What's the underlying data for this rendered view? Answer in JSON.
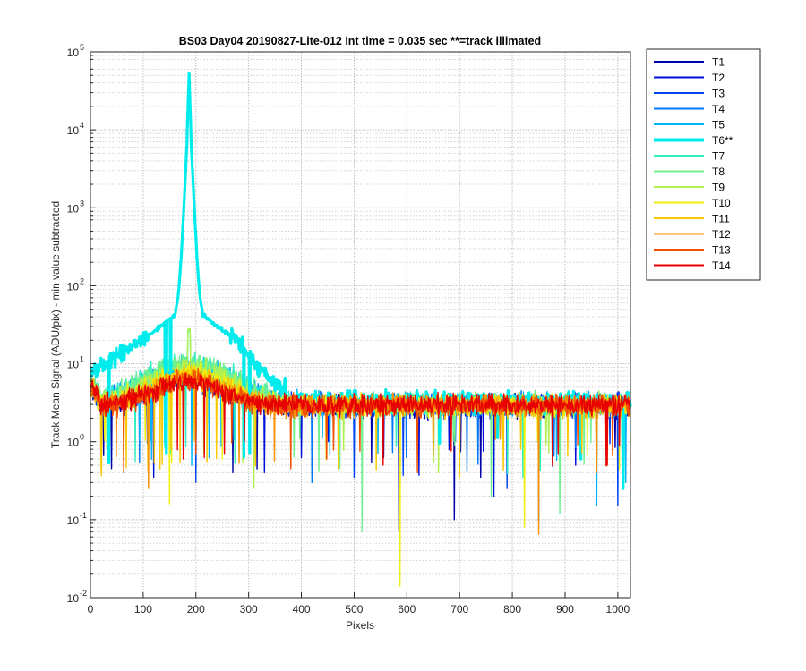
{
  "chart_data": {
    "type": "line",
    "title": "BS03 Day04 20190827-Lite-012 int time = 0.035 sec   **=track illimated",
    "xlabel": "Pixels",
    "ylabel": "Track Mean Signal (ADU/pix) - min value subtracted",
    "xlim": [
      0,
      1024
    ],
    "ylim": [
      0.01,
      100000
    ],
    "yscale": "log",
    "grid": true,
    "minor_grid": true,
    "legend_position": "outside-right-top",
    "xticks": [
      0,
      100,
      200,
      300,
      400,
      500,
      600,
      700,
      800,
      900,
      1000
    ],
    "xtick_labels": [
      "0",
      "100",
      "200",
      "300",
      "400",
      "500",
      "600",
      "700",
      "800",
      "900",
      "1000"
    ],
    "yticks": [
      0.01,
      0.1,
      1,
      10,
      100,
      1000,
      10000,
      100000
    ],
    "ytick_exponents": [
      "-2",
      "-1",
      "0",
      "1",
      "2",
      "3",
      "4",
      "5"
    ],
    "ytick_base": "10",
    "series": [
      {
        "name": "T1",
        "color": "#0000a8",
        "baseline": 2.8,
        "peak": 6.0,
        "spread": 60,
        "dips": [
          [
            40,
            0.45
          ],
          [
            270,
            0.4
          ],
          [
            585,
            0.07
          ],
          [
            690,
            0.1
          ],
          [
            740,
            0.35
          ]
        ]
      },
      {
        "name": "T2",
        "color": "#0010dc",
        "baseline": 2.9,
        "peak": 6.5,
        "spread": 60,
        "dips": [
          [
            120,
            0.35
          ],
          [
            330,
            0.4
          ],
          [
            765,
            0.2
          ],
          [
            920,
            0.5
          ]
        ]
      },
      {
        "name": "T3",
        "color": "#0044f0",
        "baseline": 2.9,
        "peak": 7.0,
        "spread": 65,
        "dips": [
          [
            200,
            0.3
          ],
          [
            500,
            0.35
          ],
          [
            790,
            0.25
          ],
          [
            1000,
            0.15
          ]
        ]
      },
      {
        "name": "T4",
        "color": "#0078f8",
        "baseline": 3.0,
        "peak": 8.0,
        "spread": 70,
        "dips": [
          [
            93,
            0.55
          ],
          [
            420,
            0.3
          ],
          [
            850,
            0.1
          ]
        ]
      },
      {
        "name": "T5",
        "color": "#00b4f8",
        "baseline": 3.0,
        "peak": 9.0,
        "spread": 75,
        "dips": [
          [
            960,
            0.15
          ],
          [
            1015,
            0.3
          ],
          [
            545,
            0.7
          ]
        ]
      },
      {
        "name": "T6**",
        "color": "#00ecec",
        "baseline": 3.2,
        "peak": 52000,
        "spread": 0,
        "dips": [
          [
            930,
            0.6
          ],
          [
            1010,
            0.25
          ]
        ]
      },
      {
        "name": "T7",
        "color": "#30f0c0",
        "baseline": 3.0,
        "peak": 10.0,
        "spread": 75,
        "dips": [
          [
            820,
            0.35
          ]
        ]
      },
      {
        "name": "T8",
        "color": "#70f090",
        "baseline": 3.0,
        "peak": 10.0,
        "spread": 70,
        "dips": [
          [
            515,
            0.07
          ],
          [
            760,
            0.2
          ],
          [
            890,
            0.12
          ]
        ]
      },
      {
        "name": "T9",
        "color": "#b0f050",
        "baseline": 3.0,
        "peak": 9.0,
        "spread": 65,
        "dips": [
          [
            310,
            0.25
          ],
          [
            660,
            0.4
          ]
        ]
      },
      {
        "name": "T10",
        "color": "#f0f010",
        "baseline": 2.9,
        "peak": 8.0,
        "spread": 60,
        "dips": [
          [
            150,
            0.16
          ],
          [
            587,
            0.014
          ],
          [
            823,
            0.08
          ],
          [
            250,
            0.6
          ]
        ]
      },
      {
        "name": "T11",
        "color": "#f8c800",
        "baseline": 2.9,
        "peak": 7.0,
        "spread": 60,
        "dips": [
          [
            20,
            0.5
          ],
          [
            470,
            0.45
          ],
          [
            700,
            0.35
          ]
        ]
      },
      {
        "name": "T12",
        "color": "#f89000",
        "baseline": 2.9,
        "peak": 6.5,
        "spread": 55,
        "dips": [
          [
            110,
            0.25
          ],
          [
            850,
            0.065
          ],
          [
            960,
            0.4
          ]
        ]
      },
      {
        "name": "T13",
        "color": "#f05000",
        "baseline": 2.9,
        "peak": 6.0,
        "spread": 55,
        "dips": [
          [
            63,
            0.4
          ],
          [
            380,
            0.45
          ],
          [
            620,
            0.4
          ]
        ]
      },
      {
        "name": "T14",
        "color": "#e80000",
        "baseline": 3.0,
        "peak": 6.0,
        "spread": 55,
        "dips": [
          [
            176,
            0.6
          ],
          [
            555,
            0.5
          ],
          [
            980,
            0.5
          ]
        ]
      }
    ],
    "peak_center_x": 187
  }
}
